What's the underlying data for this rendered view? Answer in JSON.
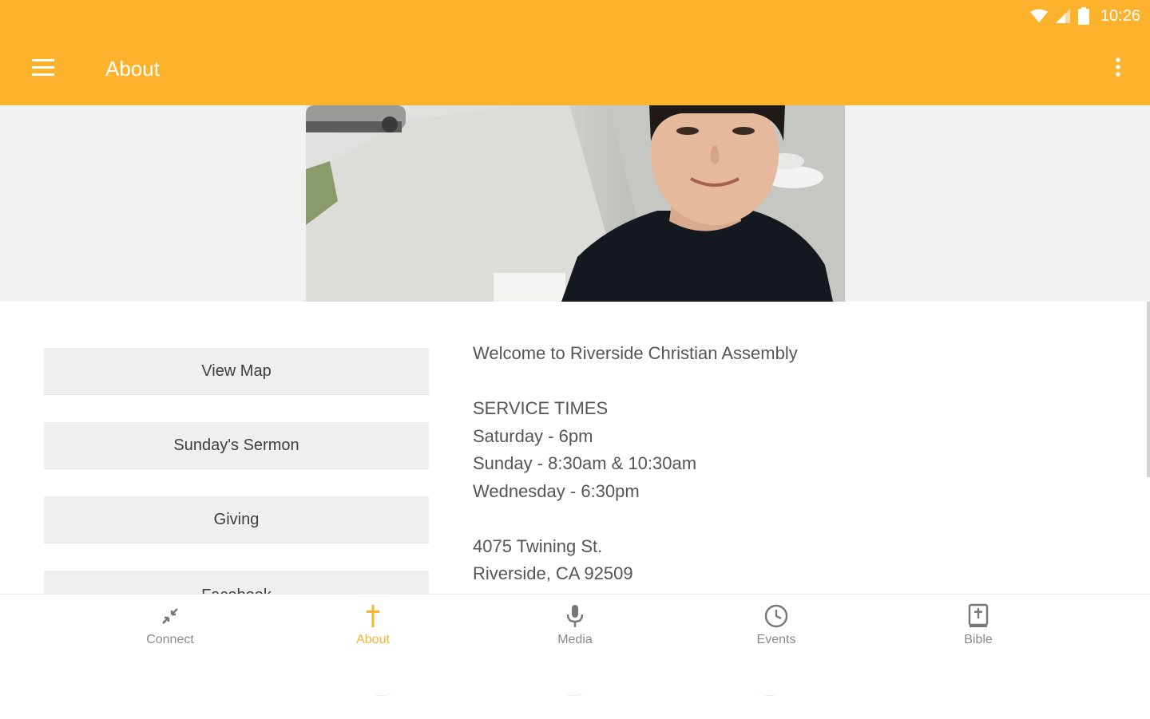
{
  "status_bar": {
    "time": "10:26",
    "icons": [
      "wifi-icon",
      "cell-signal-icon",
      "battery-icon"
    ]
  },
  "app_bar": {
    "title": "About",
    "menu_icon": "hamburger-menu-icon",
    "overflow_icon": "more-vert-icon",
    "background_color": "#fbb32d"
  },
  "hero": {
    "image": "smiling-boy-on-sidewalk-photo"
  },
  "buttons": [
    {
      "label": "View Map"
    },
    {
      "label": "Sunday's Sermon"
    },
    {
      "label": "Giving"
    },
    {
      "label": "Facebook"
    }
  ],
  "info": {
    "welcome": "Welcome to Riverside Christian Assembly",
    "service_heading": "SERVICE TIMES",
    "service_times": [
      "Saturday - 6pm",
      "Sunday - 8:30am & 10:30am",
      "Wednesday - 6:30pm"
    ],
    "address_line1": "4075 Twining St.",
    "address_line2": "Riverside, CA 92509"
  },
  "bottom_nav": [
    {
      "label": "Connect",
      "icon": "connect-arrows-icon",
      "active": false
    },
    {
      "label": "About",
      "icon": "cross-icon",
      "active": true
    },
    {
      "label": "Media",
      "icon": "microphone-icon",
      "active": false
    },
    {
      "label": "Events",
      "icon": "clock-icon",
      "active": false
    },
    {
      "label": "Bible",
      "icon": "bible-icon",
      "active": false
    }
  ],
  "colors": {
    "accent": "#fbb32d",
    "text_primary": "#555555",
    "nav_inactive": "#8a8a8a"
  }
}
